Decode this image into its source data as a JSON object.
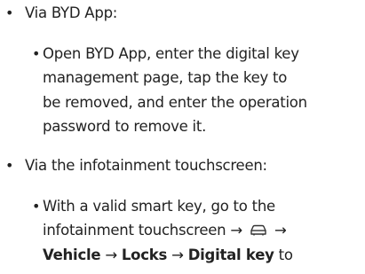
{
  "items": [
    {
      "bullet": "•",
      "label": "Via BYD App:",
      "sub": {
        "bullet": "•",
        "lines": [
          "Open BYD App, enter the digital key",
          "management page, tap the key to",
          "be removed, and enter the operation",
          "password to remove it."
        ]
      }
    },
    {
      "bullet": "•",
      "label": "Via the infotainment touchscreen:",
      "sub": {
        "bullet": "•",
        "line1": "With a valid smart key, go to the",
        "line2_prefix": "infotainment touchscreen →",
        "line2_suffix": "→",
        "path": {
          "vehicle": "Vehicle",
          "arrow1": "→",
          "locks": "Locks",
          "arrow2": "→",
          "digital_key": "Digital key",
          "tail": "to"
        }
      }
    }
  ],
  "icons": {
    "car": "car-icon"
  }
}
